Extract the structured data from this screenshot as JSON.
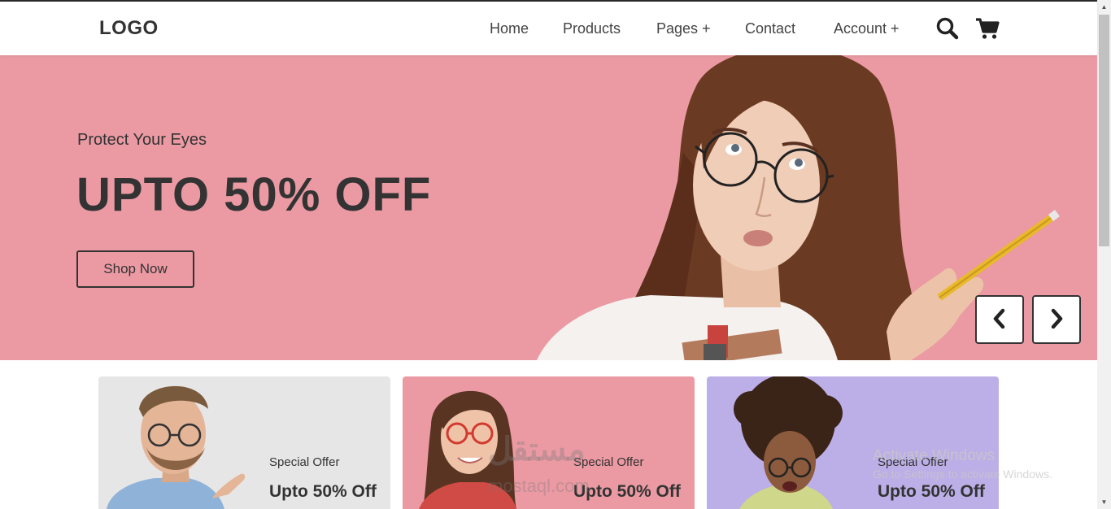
{
  "navbar": {
    "logo": "LOGO",
    "links": [
      "Home",
      "Products",
      "Pages +",
      "Contact",
      "Account +"
    ],
    "icons": [
      "search-icon",
      "cart-icon"
    ]
  },
  "hero": {
    "subtitle": "Protect Your Eyes",
    "title": "UPTO 50% OFF",
    "button_label": "Shop Now",
    "background_color": "#eb9aa3"
  },
  "cards": [
    {
      "subtitle": "Special Offer",
      "title": "Upto 50% Off",
      "background_color": "#e6e6e6"
    },
    {
      "subtitle": "Special Offer",
      "title": "Upto 50% Off",
      "background_color": "#eb9aa3"
    },
    {
      "subtitle": "Special Offer",
      "title": "Upto 50% Off",
      "background_color": "#bcaee6"
    }
  ],
  "watermark": {
    "arabic": "مستقل",
    "latin": "mostaql.com"
  },
  "windows_activation": {
    "title": "Activate Windows",
    "subtitle": "Go to Settings to activate Windows."
  }
}
